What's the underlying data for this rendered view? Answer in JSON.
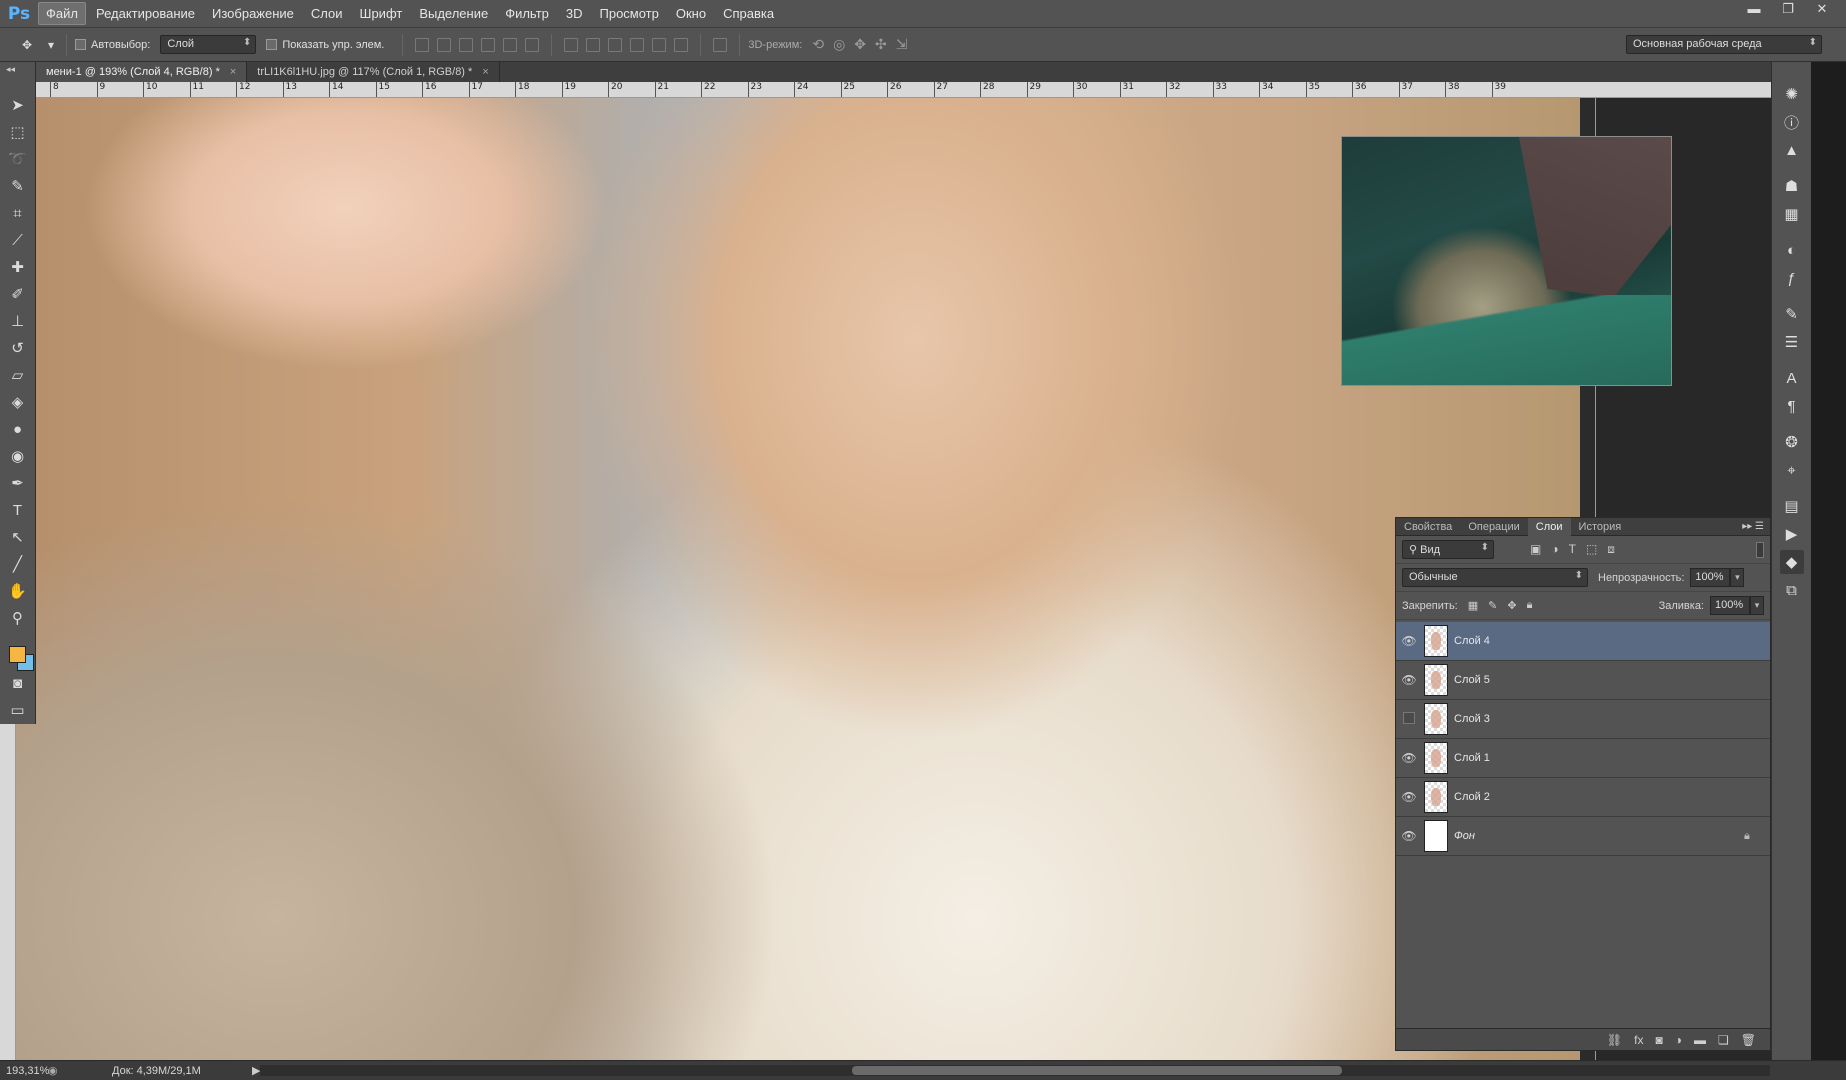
{
  "app": {
    "logo": "Ps"
  },
  "menu": [
    "Файл",
    "Редактирование",
    "Изображение",
    "Слои",
    "Шрифт",
    "Выделение",
    "Фильтр",
    "3D",
    "Просмотр",
    "Окно",
    "Справка"
  ],
  "window_controls": {
    "minimize": "▬",
    "restore": "❐",
    "close": "✕"
  },
  "options": {
    "auto_select_label": "Автовыбор:",
    "auto_select_value": "Слой",
    "show_controls_label": "Показать упр. элем.",
    "mode_3d_label": "3D-режим:",
    "workspace": "Основная рабочая среда"
  },
  "tabs": [
    {
      "label": "мени-1 @ 193% (Слой 4, RGB/8) *",
      "close": "×"
    },
    {
      "label": "trLI1K6l1HU.jpg @ 117% (Слой 1, RGB/8) *",
      "close": "×"
    }
  ],
  "ruler_ticks": [
    "8",
    "9",
    "10",
    "11",
    "12",
    "13",
    "14",
    "15",
    "16",
    "17",
    "18",
    "19",
    "20",
    "21",
    "22",
    "23",
    "24",
    "25",
    "26",
    "27",
    "28",
    "29",
    "30",
    "31",
    "32",
    "33",
    "34",
    "35",
    "36",
    "37",
    "38",
    "39"
  ],
  "layers_panel": {
    "tabs": [
      "Свойства",
      "Операции",
      "Слои",
      "История"
    ],
    "filter_label": "Вид",
    "blend_mode": "Обычные",
    "opacity_label": "Непрозрачность:",
    "opacity_value": "100%",
    "lock_label": "Закрепить:",
    "fill_label": "Заливка:",
    "fill_value": "100%",
    "layers": [
      {
        "name": "Слой 4",
        "visible": true,
        "selected": true
      },
      {
        "name": "Слой 5",
        "visible": true,
        "selected": false
      },
      {
        "name": "Слой 3",
        "visible": false,
        "selected": false
      },
      {
        "name": "Слой 1",
        "visible": true,
        "selected": false
      },
      {
        "name": "Слой 2",
        "visible": true,
        "selected": false
      },
      {
        "name": "Фон",
        "visible": true,
        "selected": false,
        "locked": true
      }
    ],
    "footer_icons": [
      "link-icon",
      "fx-icon",
      "mask-icon",
      "adjustment-icon",
      "folder-icon",
      "new-layer-icon",
      "trash-icon"
    ]
  },
  "status": {
    "zoom": "193,31%",
    "doc_info": "Док: 4,39M/29,1M"
  },
  "colors": {
    "foreground": "#f5b642",
    "background": "#74bfe8"
  }
}
